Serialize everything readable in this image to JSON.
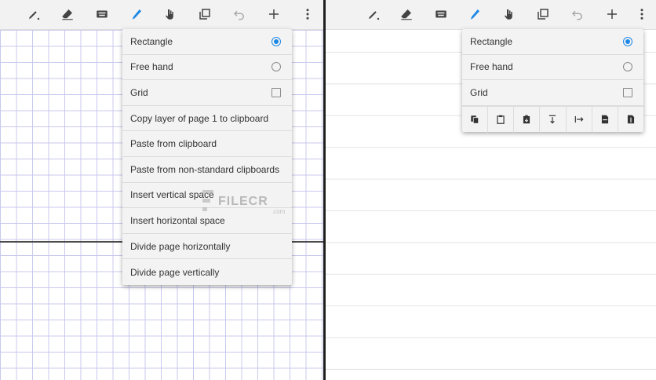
{
  "colors": {
    "accent": "#1e88e5",
    "icon": "#444444",
    "grid": "#c8c8ee",
    "toolbar_bg": "#f2f2f2",
    "menu_bg": "#f3f3f3"
  },
  "toolbar_icons": [
    "pen-icon",
    "eraser-icon",
    "keyboard-icon",
    "highlighter-icon",
    "hand-icon",
    "layers-icon",
    "undo-icon",
    "add-icon",
    "more-vert-icon"
  ],
  "left_menu": {
    "items": [
      {
        "label": "Rectangle",
        "control": "radio",
        "checked": true
      },
      {
        "label": "Free hand",
        "control": "radio",
        "checked": false
      },
      {
        "label": "Grid",
        "control": "checkbox",
        "checked": false
      },
      {
        "label": "Copy layer of page 1 to clipboard"
      },
      {
        "label": "Paste from clipboard"
      },
      {
        "label": "Paste from non-standard clipboards"
      },
      {
        "label": "Insert vertical space"
      },
      {
        "label": "Insert horizontal space"
      },
      {
        "label": "Divide page horizontally"
      },
      {
        "label": "Divide page vertically"
      }
    ]
  },
  "right_menu": {
    "items": [
      {
        "label": "Rectangle",
        "control": "radio",
        "checked": true
      },
      {
        "label": "Free hand",
        "control": "radio",
        "checked": false
      },
      {
        "label": "Grid",
        "control": "checkbox",
        "checked": false
      }
    ],
    "icon_buttons": [
      "copy-icon",
      "paste-icon",
      "paste-special-icon",
      "insert-vertical-space-icon",
      "insert-horizontal-space-icon",
      "divide-horizontal-icon",
      "divide-vertical-icon"
    ]
  },
  "watermark": {
    "text": "FILECR",
    "sub": ".com"
  }
}
